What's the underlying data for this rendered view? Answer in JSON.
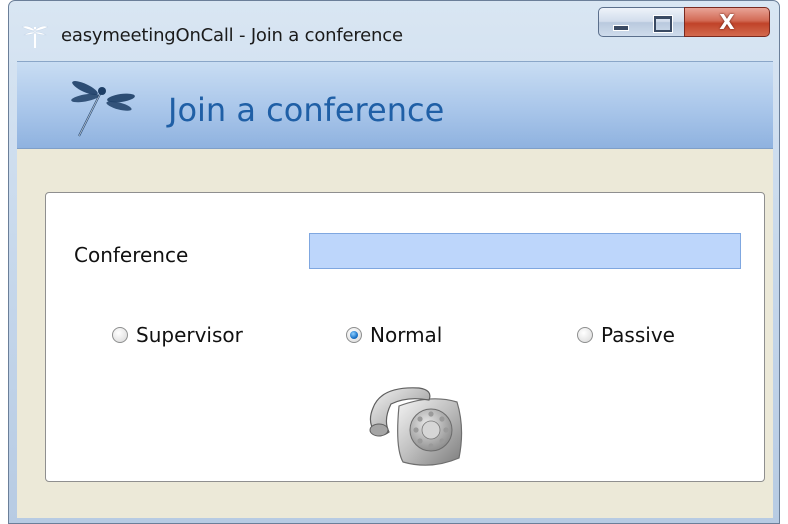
{
  "window": {
    "title": "easymeetingOnCall - Join a conference",
    "close_glyph": "X"
  },
  "header": {
    "title": "Join a conference",
    "logo_icon": "dragonfly-icon"
  },
  "form": {
    "conference_label": "Conference",
    "conference_value": "",
    "modes": [
      {
        "label": "Supervisor",
        "checked": false
      },
      {
        "label": "Normal",
        "checked": true
      },
      {
        "label": "Passive",
        "checked": false
      }
    ],
    "call_icon": "telephone-icon"
  },
  "colors": {
    "accent": "#1f5fa6",
    "input_bg": "#bdd6fb",
    "client_bg": "#ece9d8",
    "close_button": "#c04329"
  }
}
